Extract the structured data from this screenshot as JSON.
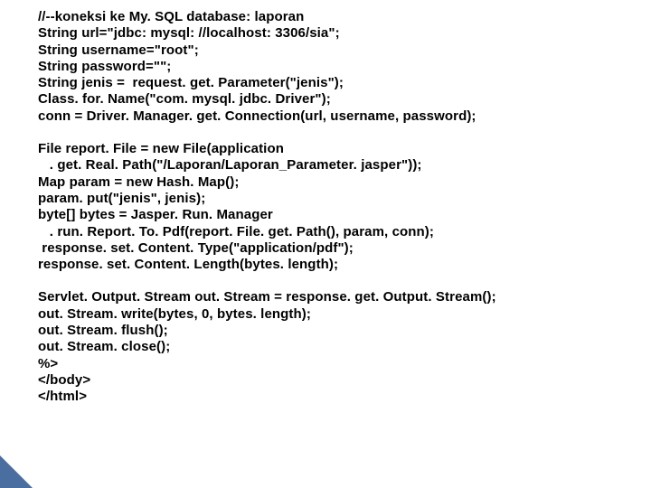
{
  "block1": [
    "//--koneksi ke My. SQL database: laporan",
    "String url=\"jdbc: mysql: //localhost: 3306/sia\";",
    "String username=\"root\";",
    "String password=\"\";",
    "String jenis =  request. get. Parameter(\"jenis\");",
    "Class. for. Name(\"com. mysql. jdbc. Driver\");",
    "conn = Driver. Manager. get. Connection(url, username, password);"
  ],
  "block2": [
    "File report. File = new File(application",
    "   . get. Real. Path(\"/Laporan/Laporan_Parameter. jasper\"));",
    "Map param = new Hash. Map();",
    "param. put(\"jenis\", jenis);",
    "byte[] bytes = Jasper. Run. Manager",
    "   . run. Report. To. Pdf(report. File. get. Path(), param, conn);",
    " response. set. Content. Type(\"application/pdf\");",
    "response. set. Content. Length(bytes. length);"
  ],
  "block3": [
    "Servlet. Output. Stream out. Stream = response. get. Output. Stream();",
    "out. Stream. write(bytes, 0, bytes. length);",
    "out. Stream. flush();",
    "out. Stream. close();",
    "%>",
    "</body>",
    "</html>"
  ]
}
